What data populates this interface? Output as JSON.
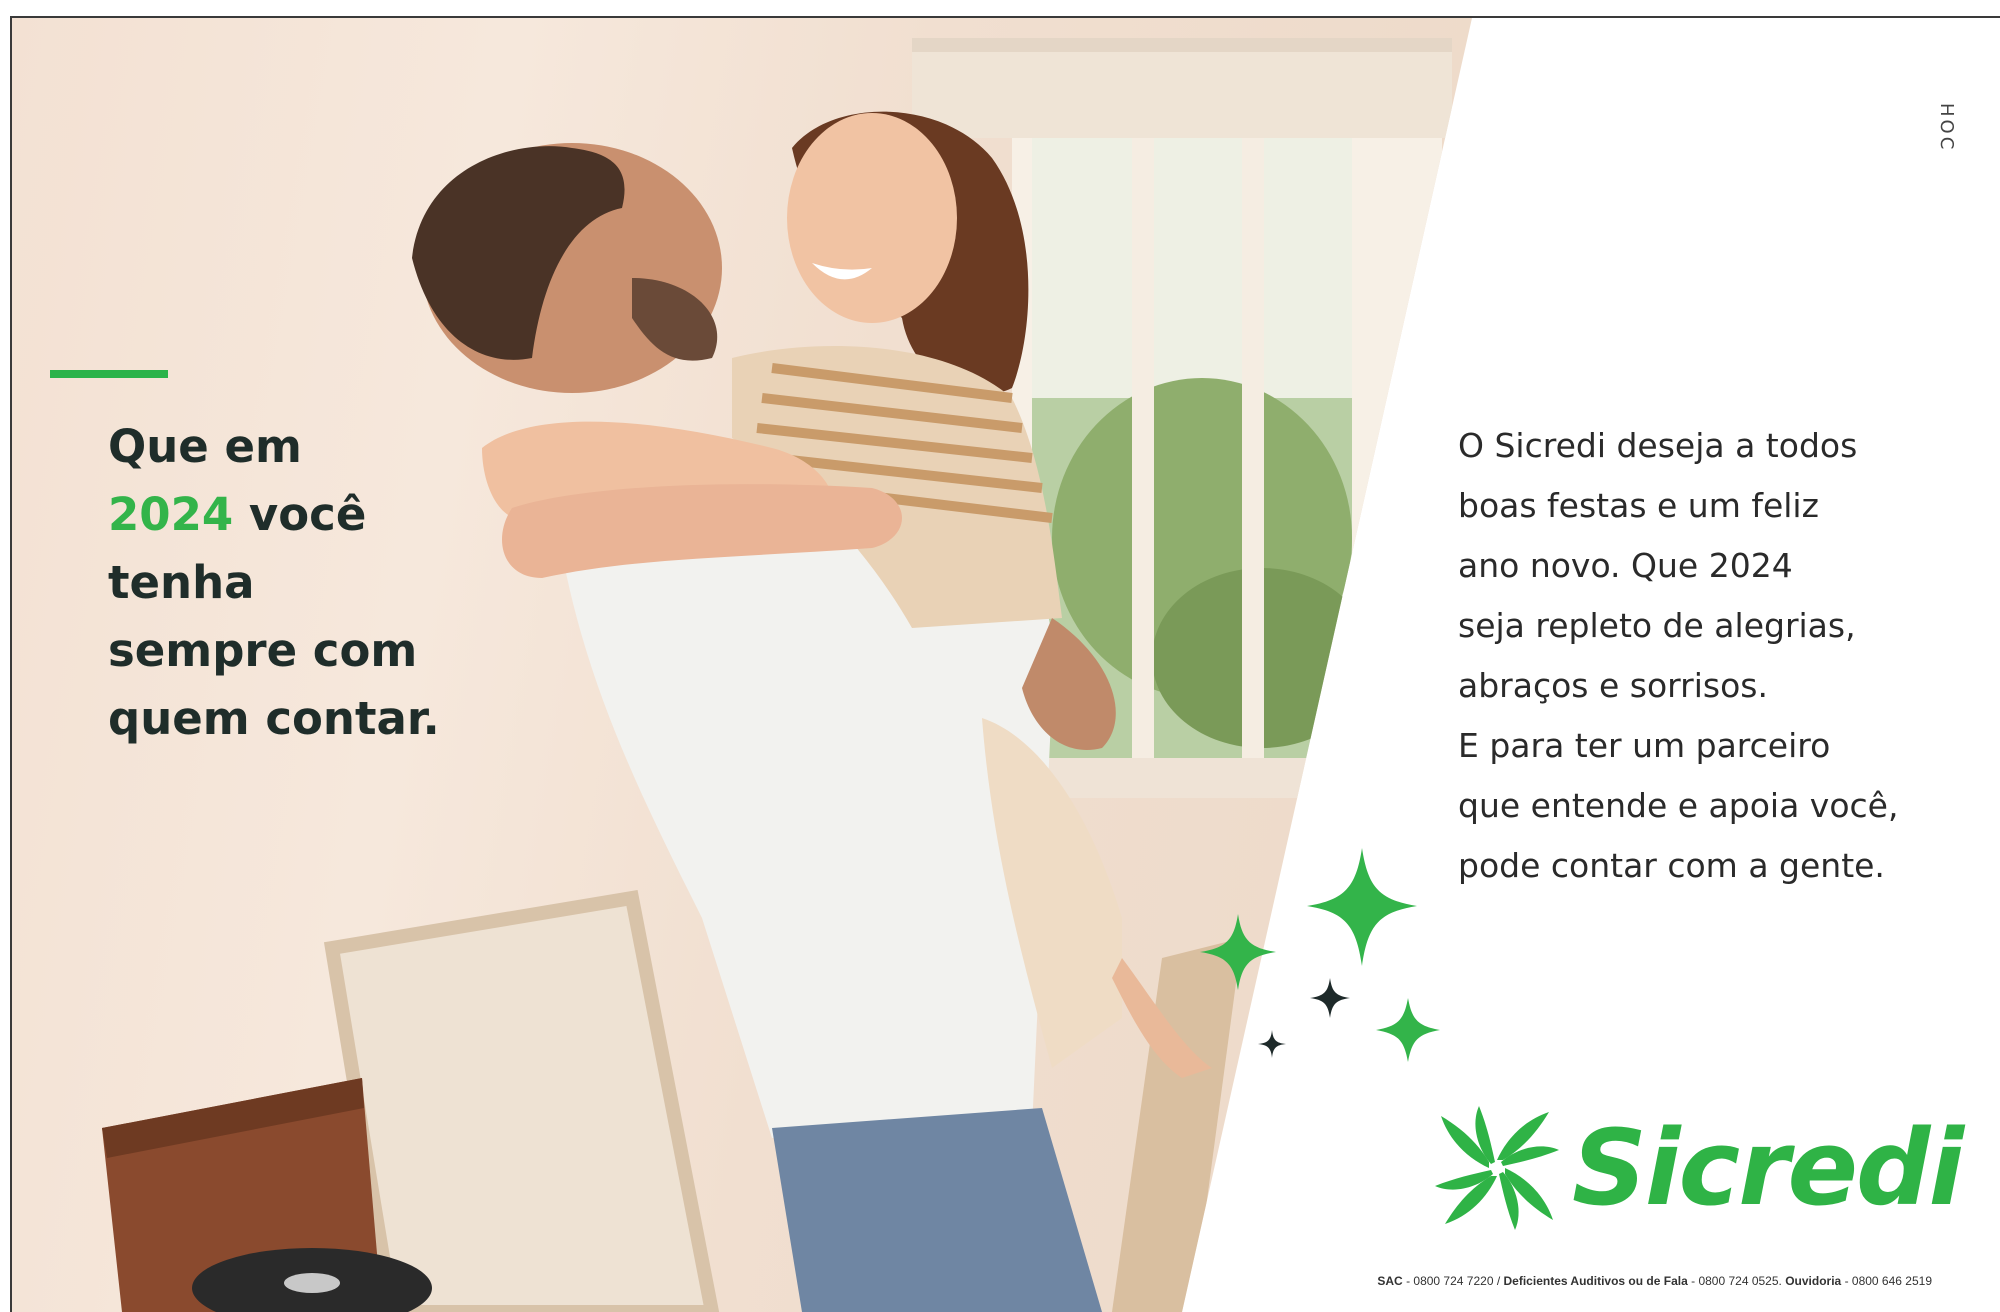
{
  "headline": {
    "line1": "Que em",
    "year": "2024",
    "line2_rest": " você",
    "line3": "tenha",
    "line4": "sempre com",
    "line5": "quem contar."
  },
  "message": {
    "lines": [
      "O Sicredi deseja a todos",
      "boas festas e um feliz",
      "ano novo. Que 2024",
      "seja repleto de alegrias,",
      "abraços e sorrisos.",
      "E para ter um parceiro",
      "que entende e apoia você,",
      "pode contar com a gente."
    ]
  },
  "side_code": "HOC",
  "brand": {
    "name": "Sicredi",
    "color": "#33b44a"
  },
  "contacts": {
    "sac_label": "SAC",
    "sac_number": "0800 724 7220",
    "deaf_label": "Deficientes Auditivos ou de Fala",
    "deaf_number": "0800 724 0525",
    "ombudsman_label": "Ouvidoria",
    "ombudsman_number": "0800 646 2519"
  },
  "colors": {
    "accent_green": "#2bb34a",
    "headline_text": "#1f2d2a",
    "sparkle_dark": "#1e2a2a"
  },
  "icons": [
    "sparkle-icon",
    "sicredi-logo-icon"
  ]
}
